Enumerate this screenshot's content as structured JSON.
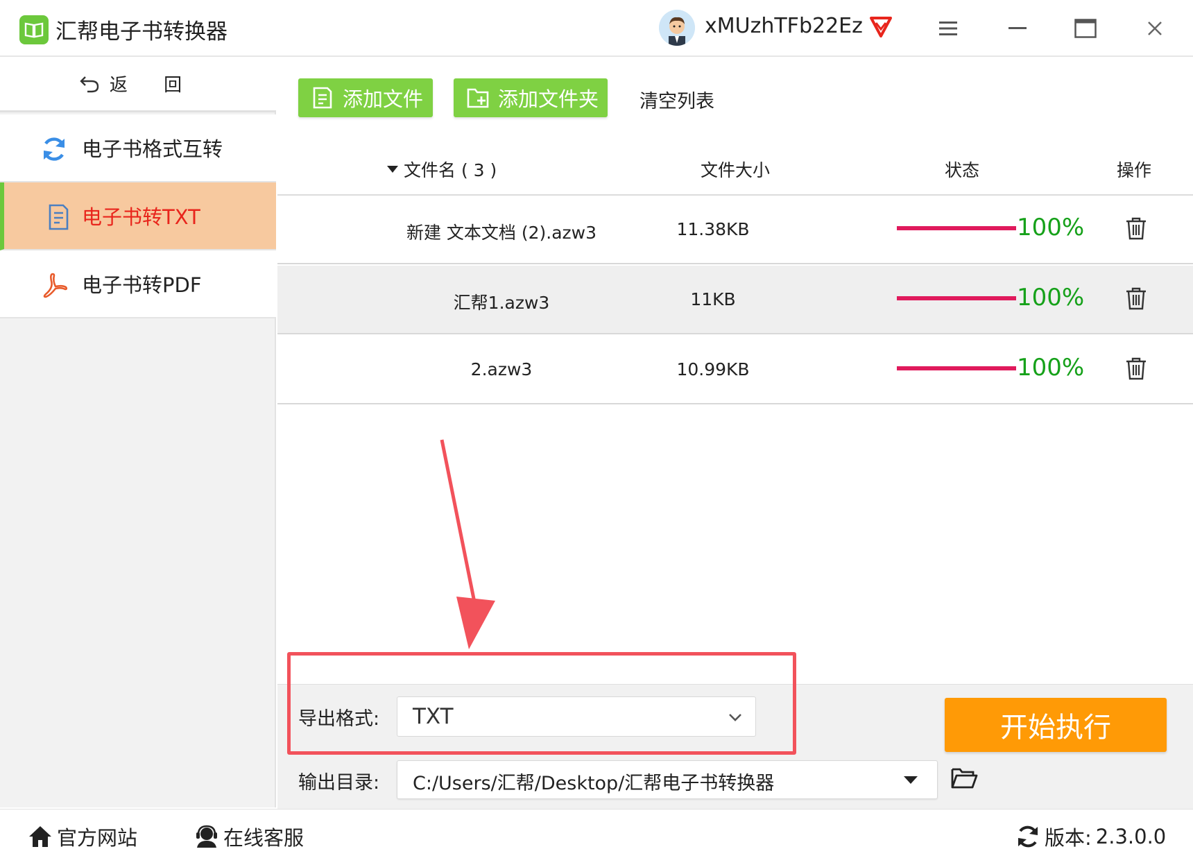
{
  "app": {
    "title": "汇帮电子书转换器"
  },
  "user": {
    "name": "xMUzhTFb22Ez"
  },
  "sidebar": {
    "back_label": "返 回",
    "items": [
      {
        "label": "电子书格式互转",
        "icon": "refresh-icon",
        "active": false
      },
      {
        "label": "电子书转TXT",
        "icon": "document-icon",
        "active": true
      },
      {
        "label": "电子书转PDF",
        "icon": "pdf-icon",
        "active": false
      }
    ]
  },
  "toolbar": {
    "add_file": "添加文件",
    "add_folder": "添加文件夹",
    "clear_list": "清空列表"
  },
  "table": {
    "headers": {
      "name": "文件名 ( 3 )",
      "size": "文件大小",
      "status": "状态",
      "action": "操作"
    },
    "rows": [
      {
        "name": "新建 文本文档 (2).azw3",
        "size": "11.38KB",
        "progress": 100,
        "progress_text": "100%"
      },
      {
        "name": "汇帮1.azw3",
        "size": "11KB",
        "progress": 100,
        "progress_text": "100%"
      },
      {
        "name": "2.azw3",
        "size": "10.99KB",
        "progress": 100,
        "progress_text": "100%"
      }
    ]
  },
  "settings": {
    "export_label": "导出格式:",
    "export_value": "TXT",
    "output_label": "输出目录:",
    "output_value": "C:/Users/汇帮/Desktop/汇帮电子书转换器",
    "start_label": "开始执行"
  },
  "footer": {
    "website": "官方网站",
    "support": "在线客服",
    "version_label": "版本:",
    "version_value": "2.3.0.0"
  },
  "colors": {
    "accent_green": "#7fd143",
    "active_bg": "#f7c99f",
    "active_text": "#e8251c",
    "progress": "#e01a5c",
    "percent": "#16a11a",
    "start": "#ff9a06",
    "annotation": "#f2525b"
  }
}
